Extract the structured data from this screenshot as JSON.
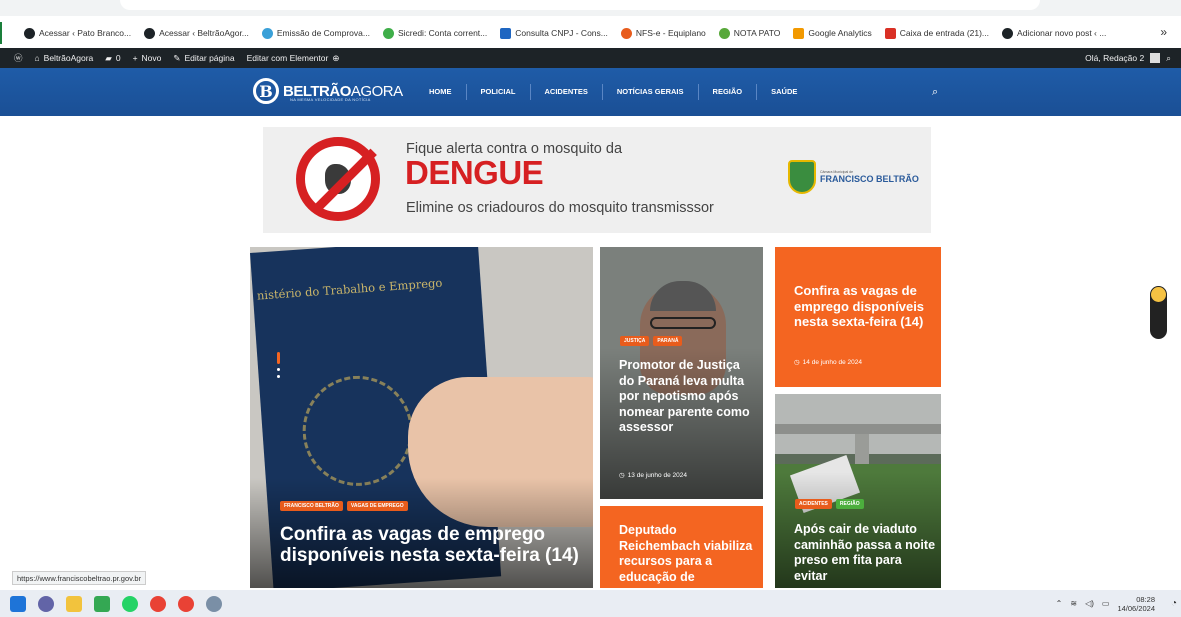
{
  "bookmarks": [
    {
      "label": "Acessar ‹ Pato Branco...",
      "color": "#1d2327"
    },
    {
      "label": "Acessar ‹ BeltrãoAgor...",
      "color": "#1d2327"
    },
    {
      "label": "Emissão de Comprova...",
      "color": "#3aa0d8"
    },
    {
      "label": "Sicredi: Conta corrent...",
      "color": "#3fae49"
    },
    {
      "label": "Consulta CNPJ - Cons...",
      "color": "#1f66c1"
    },
    {
      "label": "NFS-e - Equiplano",
      "color": "#e85c1c"
    },
    {
      "label": "NOTA PATO",
      "color": "#58a83a"
    },
    {
      "label": "Google Analytics",
      "color": "#f29900"
    },
    {
      "label": "Caixa de entrada (21)...",
      "color": "#d93025"
    },
    {
      "label": "Adicionar novo post ‹ ...",
      "color": "#1d2327"
    }
  ],
  "bookmarks_more": "»",
  "wpbar": {
    "site": "BeltrãoAgora",
    "comments": "0",
    "new": "Novo",
    "edit": "Editar página",
    "elementor": "Editar com Elementor",
    "greeting": "Olá, Redação 2"
  },
  "nav": {
    "logo_bold": "BELTRÃO",
    "logo_thin": "AGORA",
    "logo_sub": "NA MESMA VELOCIDADE DA NOTÍCIA",
    "logo_letter": "B",
    "menu": [
      "HOME",
      "POLICIAL",
      "ACIDENTES",
      "NOTÍCIAS GERAIS",
      "REGIÃO",
      "SAÚDE"
    ],
    "search_icon": "⌕"
  },
  "banner": {
    "line1": "Fique alerta contra o mosquito da",
    "line2": "DENGUE",
    "line3_a": "Elimine os ",
    "line3_b": "criadouros",
    "line3_c": " do mosquito transmisssor",
    "camara_small": "Câmara Municipal de",
    "camara_big": "FRANCISCO BELTRÃO"
  },
  "featured": {
    "ministry": "nistério do Trabalho e Emprego",
    "tags": [
      "FRANCISCO BELTRÃO",
      "VAGAS DE EMPREGO"
    ],
    "title": "Confira as vagas de emprego disponíveis nesta sexta-feira (14)"
  },
  "cards": [
    {
      "tags": [
        "JUSTIÇA",
        "PARANÁ"
      ],
      "title": "Promotor de Justiça do Paraná leva multa por nepotismo após nomear parente como assessor",
      "date": "13 de junho de 2024"
    },
    {
      "title": "Confira as vagas de emprego disponíveis nesta sexta-feira (14)",
      "date": "14 de junho de 2024"
    },
    {
      "tags": [
        "ACIDENTES",
        "REGIÃO"
      ],
      "title": "Após cair de viaduto caminhão passa a noite preso em fita para evitar"
    },
    {
      "title": "Deputado Reichembach viabiliza recursos para a educação de"
    }
  ],
  "status_url": "https://www.franciscobeltrao.pr.gov.br",
  "taskbar": {
    "time": "08:28",
    "date": "14/06/2024"
  },
  "colors": {
    "nav": "#1f5ca8",
    "accent": "#f46521",
    "wpbar": "#1d2327",
    "dengue": "#d62022"
  }
}
